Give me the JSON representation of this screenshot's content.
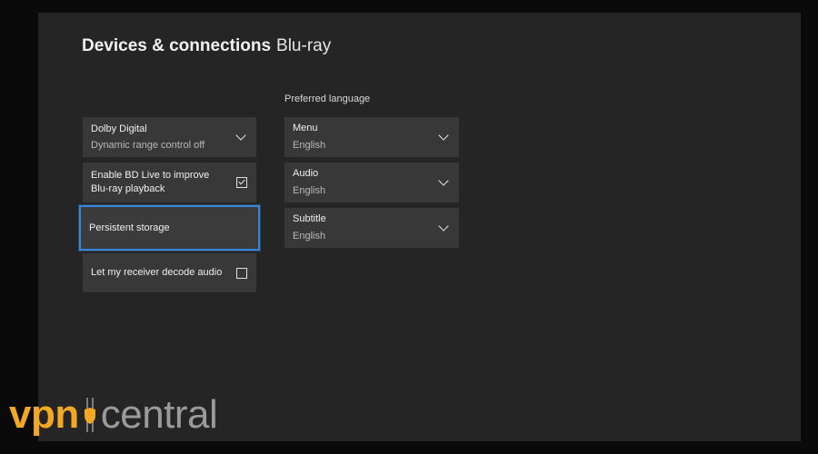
{
  "header": {
    "title_bold": "Devices & connections",
    "title_light": "Blu-ray"
  },
  "left_settings": {
    "dolby": {
      "label": "Dolby Digital",
      "value": "Dynamic range control off"
    },
    "bd_live": {
      "label": "Enable BD Live to improve Blu-ray playback",
      "checked": true
    },
    "persistent_storage": {
      "label": "Persistent storage",
      "focused": true
    },
    "receiver_decode": {
      "label": "Let my receiver decode audio",
      "checked": false
    }
  },
  "preferred_language": {
    "heading": "Preferred language",
    "menu": {
      "label": "Menu",
      "value": "English"
    },
    "audio": {
      "label": "Audio",
      "value": "English"
    },
    "subtitle": {
      "label": "Subtitle",
      "value": "English"
    }
  },
  "watermark": {
    "brand_a": "vpn",
    "brand_b": "central"
  },
  "colors": {
    "focus": "#3a86d6",
    "brand": "#f2a823",
    "tile": "#383838",
    "panel": "#252525"
  },
  "icons": {
    "dropdown": "chevron-down-icon",
    "checkbox": "checkbox-icon"
  }
}
